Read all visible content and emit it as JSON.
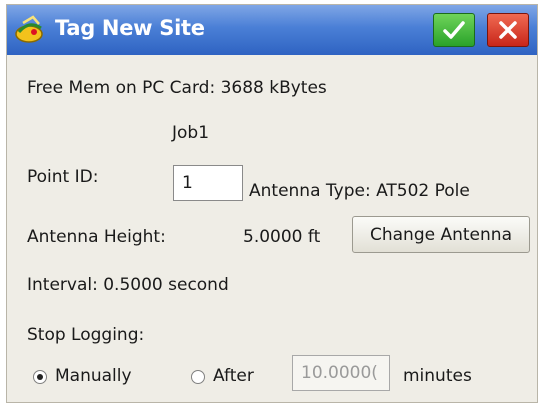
{
  "window": {
    "title": "Tag New Site",
    "ok_icon": "check-icon",
    "close_icon": "close-icon",
    "colors": {
      "titlebar": "#3a6fcf",
      "ok": "#2aa22a",
      "close": "#c8261a"
    }
  },
  "info": {
    "free_mem": "Free Mem on PC Card: 3688 kBytes",
    "job_name": "Job1"
  },
  "point": {
    "label": "Point ID:",
    "value": "1"
  },
  "antenna": {
    "type_text": "Antenna Type: AT502 Pole",
    "height_label": "Antenna Height:",
    "height_value": "5.0000 ft",
    "change_button": "Change Antenna"
  },
  "interval": {
    "text": "Interval: 0.5000 second"
  },
  "stop_logging": {
    "label": "Stop Logging:",
    "options": [
      {
        "label": "Manually",
        "selected": true
      },
      {
        "label": "After",
        "selected": false
      }
    ],
    "after_value": "10.0000(",
    "units": "minutes"
  }
}
